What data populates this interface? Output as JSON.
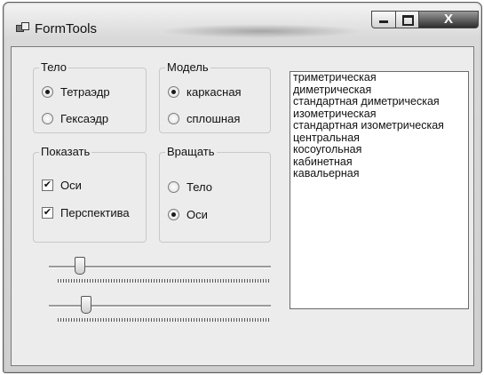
{
  "window": {
    "title": "FormTools",
    "close_glyph": "X"
  },
  "groups": {
    "body": {
      "label": "Тело",
      "options": [
        {
          "label": "Тетраэдр",
          "checked": true
        },
        {
          "label": "Гексаэдр",
          "checked": false
        }
      ]
    },
    "model": {
      "label": "Модель",
      "options": [
        {
          "label": "каркасная",
          "checked": true
        },
        {
          "label": "сплошная",
          "checked": false
        }
      ]
    },
    "show": {
      "label": "Показать",
      "options": [
        {
          "label": "Оси",
          "checked": true
        },
        {
          "label": "Перспектива",
          "checked": true
        }
      ]
    },
    "rotate": {
      "label": "Вращать",
      "options": [
        {
          "label": "Тело",
          "checked": false
        },
        {
          "label": "Оси",
          "checked": true
        }
      ]
    }
  },
  "sliders": [
    {
      "value": 0.12
    },
    {
      "value": 0.15
    }
  ],
  "projections": [
    "триметрическая",
    "диметрическая",
    "стандартная диметрическая",
    "изометрическая",
    "стандартная изометрическая",
    "центральная",
    "косоугольная",
    "кабинетная",
    "кавальерная"
  ],
  "icons": {
    "app": "window-app-icon",
    "min": "minimize-icon",
    "max": "maximize-icon",
    "close": "close-icon"
  }
}
